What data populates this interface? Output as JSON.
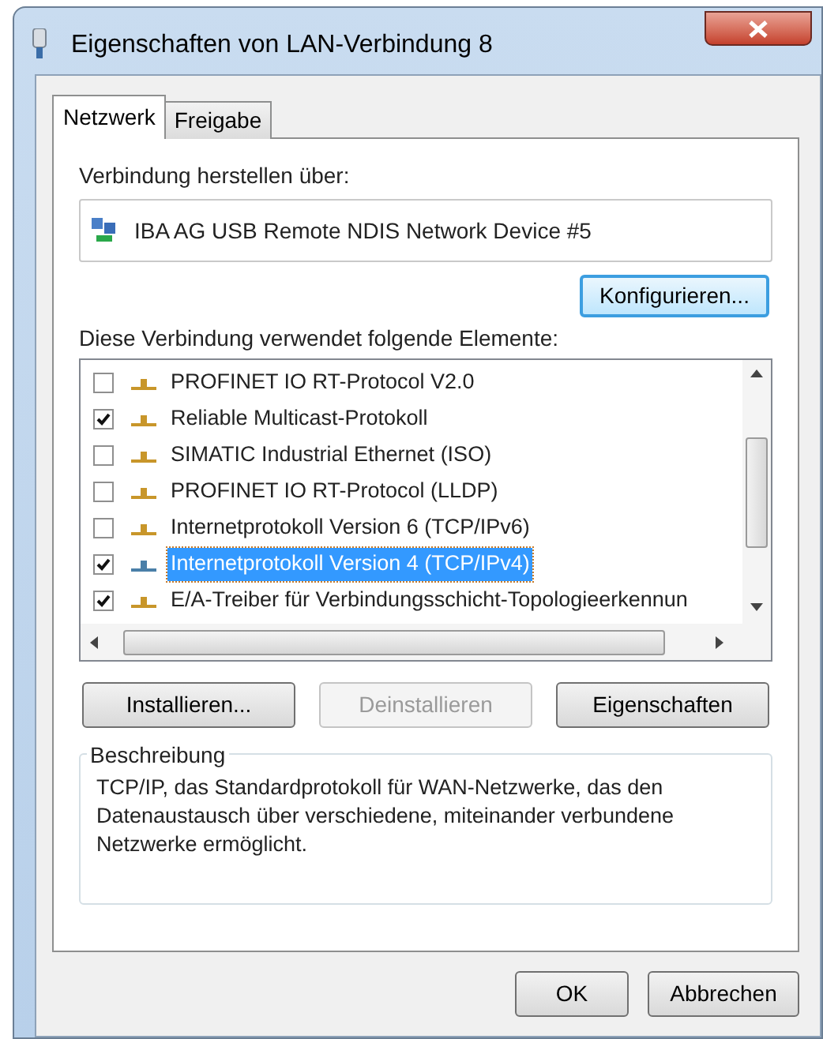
{
  "window": {
    "title": "Eigenschaften von LAN-Verbindung 8"
  },
  "tabs": [
    {
      "label": "Netzwerk",
      "selected": true
    },
    {
      "label": "Freigabe",
      "selected": false
    }
  ],
  "connect_via": {
    "label": "Verbindung herstellen über:",
    "device": "IBA AG USB Remote NDIS Network Device #5"
  },
  "configure_button": "Konfigurieren...",
  "items_label": "Diese Verbindung verwendet folgende Elemente:",
  "items": [
    {
      "label": "PROFINET IO RT-Protocol V2.0",
      "checked": false,
      "selected": false
    },
    {
      "label": "Reliable Multicast-Protokoll",
      "checked": true,
      "selected": false
    },
    {
      "label": "SIMATIC Industrial Ethernet (ISO)",
      "checked": false,
      "selected": false
    },
    {
      "label": "PROFINET IO RT-Protocol (LLDP)",
      "checked": false,
      "selected": false
    },
    {
      "label": "Internetprotokoll Version 6 (TCP/IPv6)",
      "checked": false,
      "selected": false
    },
    {
      "label": "Internetprotokoll Version 4 (TCP/IPv4)",
      "checked": true,
      "selected": true
    },
    {
      "label": "E/A-Treiber für Verbindungsschicht-Topologieerkennun",
      "checked": true,
      "selected": false
    }
  ],
  "item_buttons": [
    {
      "label": "Installieren...",
      "disabled": false
    },
    {
      "label": "Deinstallieren",
      "disabled": true
    },
    {
      "label": "Eigenschaften",
      "disabled": false
    }
  ],
  "description": {
    "title": "Beschreibung",
    "text": "TCP/IP, das Standardprotokoll für WAN-Netzwerke, das den Datenaustausch über verschiedene, miteinander verbundene Netzwerke ermöglicht."
  },
  "dialog_buttons": [
    "OK",
    "Abbrechen"
  ]
}
